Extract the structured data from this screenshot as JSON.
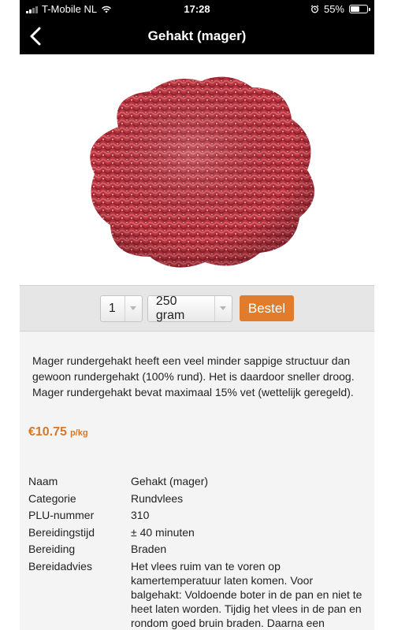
{
  "status_bar": {
    "carrier": "T-Mobile NL",
    "time": "17:28",
    "battery": "55%",
    "battery_level": 0.55
  },
  "nav": {
    "title": "Gehakt (mager)"
  },
  "order": {
    "quantity": "1",
    "weight": "250 gram",
    "order_button": "Bestel"
  },
  "description": "Mager rundergehakt heeft een veel minder sappige structuur dan gewoon rundergehakt (100% rund). Het is daardoor sneller droog. Mager rundergehakt bevat maximaal 15% vet (wettelijk geregeld).",
  "price": {
    "value": "€10.75",
    "unit": "p/kg"
  },
  "details": [
    {
      "label": "Naam",
      "value": "Gehakt (mager)"
    },
    {
      "label": "Categorie",
      "value": "Rundvlees"
    },
    {
      "label": "PLU-nummer",
      "value": "310"
    },
    {
      "label": "Bereidingstijd",
      "value": "± 40 minuten"
    },
    {
      "label": "Bereiding",
      "value": "Braden"
    },
    {
      "label": "Bereidadvies",
      "value": "Het vlees ruim van te voren op kamertemperatuur laten komen. Voor balgehakt: Voldoende boter in de pan en niet te heet laten worden. Tijdig het vlees in de pan en rondom goed bruin braden. Daarna een"
    }
  ],
  "colors": {
    "accent": "#e07c2c",
    "price": "#d4782c",
    "nav_background": "#000000"
  },
  "icons": {
    "back": "chevron-left-icon",
    "alarm": "alarm-clock-icon",
    "wifi": "wifi-icon"
  }
}
